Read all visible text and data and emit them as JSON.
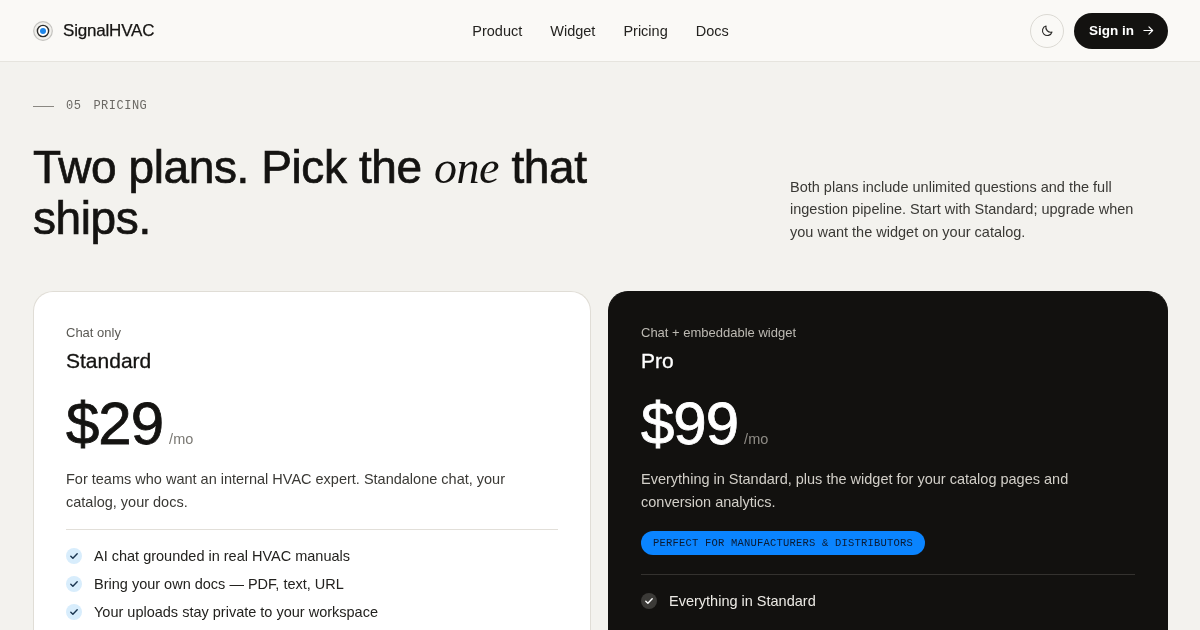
{
  "nav": {
    "brand": "SignalHVAC",
    "links": [
      {
        "label": "Product"
      },
      {
        "label": "Widget"
      },
      {
        "label": "Pricing"
      },
      {
        "label": "Docs"
      }
    ],
    "sign_in": "Sign in"
  },
  "section": {
    "number": "05",
    "label": "PRICING"
  },
  "heading": "Two plans. Pick the *one* that ships.",
  "intro": "Both plans include unlimited questions and the full ingestion pipeline. Start with Standard; upgrade when you want the widget on your catalog.",
  "plans": [
    {
      "kind": "standard",
      "tagline": "Chat only",
      "name": "Standard",
      "price": "$29",
      "period": "/mo",
      "description": "For teams who want an internal HVAC expert. Standalone chat, your catalog, your docs.",
      "features": [
        "AI chat grounded in real HVAC manuals",
        "Bring your own docs — PDF, text, URL",
        "Your uploads stay private to your workspace"
      ]
    },
    {
      "kind": "featured",
      "tagline": "Chat + embeddable widget",
      "name": "Pro",
      "price": "$99",
      "period": "/mo",
      "description": "Everything in Standard, plus the widget for your catalog pages and conversion analytics.",
      "badge": "PERFECT FOR MANUFACTURERS & DISTRIBUTORS",
      "features": [
        "Everything in Standard"
      ]
    }
  ]
}
